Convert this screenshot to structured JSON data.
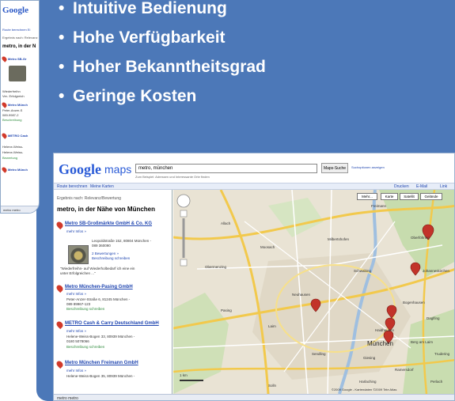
{
  "slide": {
    "bullets": [
      "Intuitive Bedienung",
      "Hohe Verfügbarkeit",
      "Hoher Bekanntheitsgrad",
      "Geringe Kosten"
    ],
    "bullet_char": "•",
    "panel_color": "#4c78b8"
  },
  "small_shot": {
    "logo": "Google",
    "top_links": "Route berechnen  Ei",
    "search_hint": "Ergebnis nach: Relevanz",
    "results_title": "metro, in der N",
    "items": [
      "Metro SB-Gr",
      "Metro Münch",
      "METRO Cash",
      "Metro Münch"
    ],
    "details": [
      "Wiederfreihn",
      "Ver- Erfolgreich",
      "Peter-Anzer-S",
      "089-9987-2",
      "Beschreibung",
      "Helene-Weiss-",
      "Helene-Weiss-",
      "Bewertung"
    ],
    "bottom": "metro  metro"
  },
  "main_shot": {
    "logo": "Google",
    "product": "maps",
    "search_value": "metro, münchen",
    "search_button": "Maps-Suche",
    "options_link": "Suchoptionen anzeigen",
    "hint": "Zum Beispiel: Adressen und Interessante Orte finden",
    "tabs": [
      "Route berechnen",
      "Meine Karten"
    ],
    "right_links": [
      "Drucken",
      "E-Mail",
      "Link"
    ],
    "map_types": [
      "Mehr...",
      "Karte",
      "Satellit",
      "Gelände"
    ],
    "sidebar": {
      "sort_label": "Ergebnis nach: Relevanz/Bewertung",
      "heading": "metro, in der Nähe von München",
      "results": [
        {
          "title": "Metro SB-Großmärkte GmbH & Co. KG",
          "lines": [
            "mehr Infos »",
            "Leopoldstraße 152, 80804 München -",
            "089 360090",
            "2 Bewertungen »",
            "Beschreibung schreiben",
            "\"Wiederfreihn- auf Wiederholbedarf ich eine ein",
            "unter Erfolgreichen ...\""
          ]
        },
        {
          "title": "Metro München-Pasing GmbH",
          "lines": [
            "mehr Infos »",
            "Peter-Anzer-Straße 6, 81245 München -",
            "089 89967-123",
            "Beschreibung schreiben"
          ]
        },
        {
          "title": "METRO Cash & Carry Deutschland GmbH",
          "lines": [
            "mehr Infos »",
            "Helene-Weiss-Bogen 33, 80939 München -",
            "0180 5078066",
            "Beschreibung schreiben"
          ]
        },
        {
          "title": "Metro München Freimann GmbH",
          "lines": [
            "mehr Infos »",
            "Helene-Weiss-Bogen 35, 80939 München -"
          ]
        }
      ],
      "bottom": "metro    metro"
    },
    "map": {
      "city_label": "München",
      "labels": [
        "Freimann",
        "Oberföhring",
        "Milbertshofen",
        "Bogenhausen",
        "Schwabing",
        "Neuhausen",
        "Pasing",
        "Laim",
        "Sendling",
        "Giesing",
        "Haidhausen",
        "Berg am Laim",
        "Trudering",
        "Harlaching",
        "Solln",
        "Obermenzing",
        "Allach",
        "Moosach",
        "Johanneskirchen",
        "Daglfing",
        "Ramersdorf",
        "Perlach"
      ],
      "copyright": "©2009 Google - Kartendaten ©2009 Tele Atlas",
      "scale": "1 km"
    }
  }
}
